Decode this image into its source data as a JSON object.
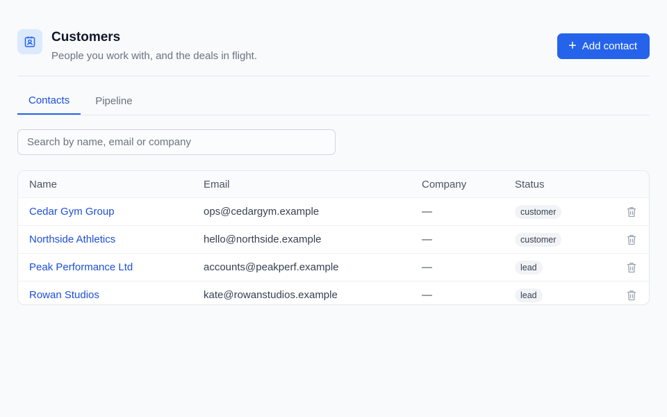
{
  "header": {
    "title": "Customers",
    "subtitle": "People you work with, and the deals in flight.",
    "icon": "contact-card-icon",
    "add_button_label": "Add contact"
  },
  "tabs": [
    {
      "label": "Contacts",
      "active": true
    },
    {
      "label": "Pipeline",
      "active": false
    }
  ],
  "search": {
    "placeholder": "Search by name, email or company",
    "value": ""
  },
  "table": {
    "columns": [
      "Name",
      "Email",
      "Company",
      "Status"
    ],
    "rows": [
      {
        "name": "Cedar Gym Group",
        "email": "ops@cedargym.example",
        "company": "—",
        "status": "customer"
      },
      {
        "name": "Northside Athletics",
        "email": "hello@northside.example",
        "company": "—",
        "status": "customer"
      },
      {
        "name": "Peak Performance Ltd",
        "email": "accounts@peakperf.example",
        "company": "—",
        "status": "lead"
      },
      {
        "name": "Rowan Studios",
        "email": "kate@rowanstudios.example",
        "company": "—",
        "status": "lead"
      }
    ]
  },
  "colors": {
    "accent": "#2563eb",
    "link": "#1d4ed8",
    "background": "#f8fafc",
    "icon_bg": "#dbeafe"
  }
}
